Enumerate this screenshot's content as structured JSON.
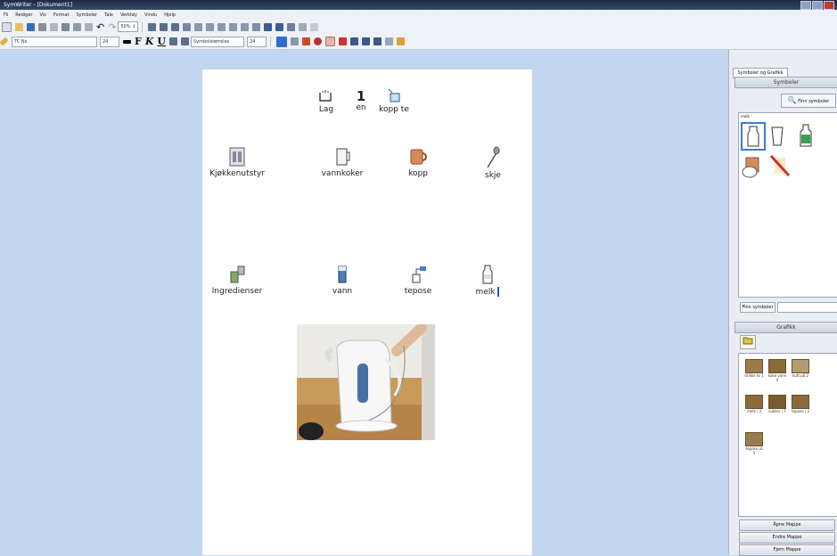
{
  "window": {
    "title": "SymWriter - [Dokument1]"
  },
  "menu": [
    "Fil",
    "Rediger",
    "Vis",
    "Format",
    "Symboler",
    "Tale",
    "Verktøy",
    "Vindu",
    "Hjelp"
  ],
  "toolbar": {
    "zoom": "50% ↕",
    "font": "TC Ns",
    "font_size": "24",
    "bold": "F",
    "italic": "K",
    "underline": "U",
    "symbol_size": "Symbolstørrelse",
    "symbol_size_value": "24"
  },
  "document": {
    "header": {
      "number": "1",
      "words": [
        "Lag",
        "en",
        "kopp te"
      ]
    },
    "row1": [
      "Kjøkkenutstyr",
      "vannkoker",
      "kopp",
      "skje"
    ],
    "row2": [
      "Ingredienser",
      "vann",
      "tepose",
      "melk"
    ]
  },
  "panel": {
    "tab": "Symboler og Grafikk",
    "symbols_header": "Symboler",
    "find_button": "Finn symboler",
    "symbols_word": "melk",
    "symbols_footer_button": "Finn symboler",
    "graphics_header": "Grafikk",
    "thumbs": [
      {
        "label": "drikke te 1"
      },
      {
        "label": "koke vann 4"
      },
      {
        "label": "kutt på 2"
      },
      {
        "label": "melk i 3"
      },
      {
        "label": "sukker i 7"
      },
      {
        "label": "tepose i 3"
      },
      {
        "label": "tepose ut 5"
      }
    ],
    "buttons": [
      "Åpne Mappe",
      "Endre Mappe",
      "Fjern Mappe"
    ]
  }
}
